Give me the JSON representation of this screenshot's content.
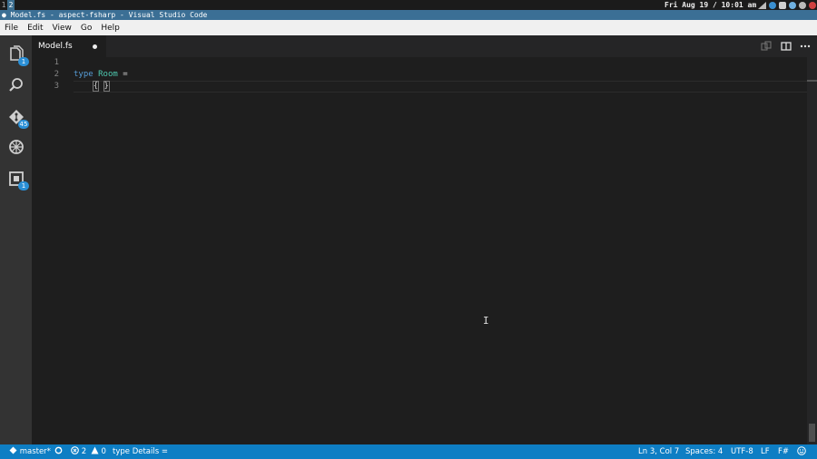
{
  "system_bar": {
    "workspaces": [
      "1",
      "2"
    ],
    "clock": "Fri Aug 19 / 10:01 am",
    "tray_icons": [
      "wifi-icon",
      "bluetooth-icon",
      "volume-icon",
      "network-icon",
      "settings-icon",
      "power-icon"
    ]
  },
  "window": {
    "title": "● Model.fs - aspect-fsharp - Visual Studio Code"
  },
  "menu": {
    "items": [
      "File",
      "Edit",
      "View",
      "Go",
      "Help"
    ]
  },
  "activity_bar": {
    "items": [
      {
        "name": "explorer",
        "icon": "files-icon",
        "badge": "1"
      },
      {
        "name": "search",
        "icon": "search-icon",
        "badge": ""
      },
      {
        "name": "git",
        "icon": "git-icon",
        "badge": "45"
      },
      {
        "name": "debug",
        "icon": "debug-icon",
        "badge": ""
      },
      {
        "name": "extensions",
        "icon": "extensions-icon",
        "badge": "1"
      }
    ]
  },
  "tabs": [
    {
      "label": "Model.fs",
      "dirty": true
    }
  ],
  "editor": {
    "line_numbers": [
      "1",
      "2",
      "3"
    ],
    "lines": {
      "line1": "",
      "line2_kw": "type",
      "line2_name": "Room",
      "line2_rest": " =",
      "line3_indent": "    ",
      "line3_open": "{",
      "line3_close": "}"
    }
  },
  "status": {
    "branch": "master*",
    "errors": "2",
    "warnings": "0",
    "message": "type Details =",
    "position": "Ln 3, Col 7",
    "spaces": "Spaces: 4",
    "encoding": "UTF-8",
    "eol": "LF",
    "language": "F#"
  },
  "colors": {
    "accent": "#0e7ec4",
    "titlebar": "#3b6f95",
    "keyword": "#569cd6",
    "type": "#4ec9b0"
  }
}
